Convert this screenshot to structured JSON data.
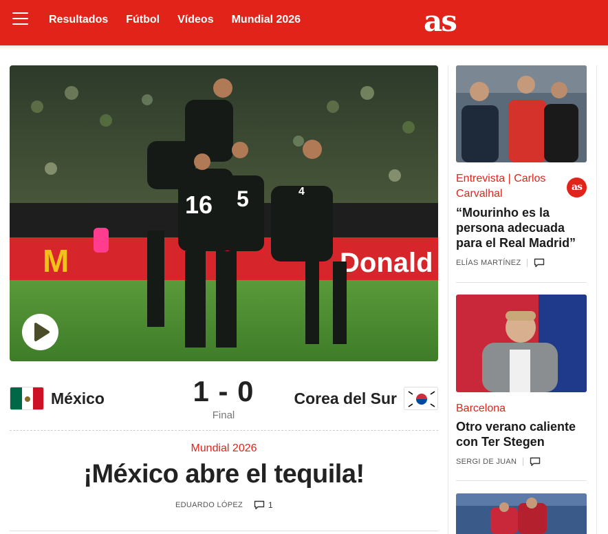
{
  "header": {
    "logo": "as",
    "nav": [
      "Resultados",
      "Fútbol",
      "Vídeos",
      "Mundial 2026"
    ]
  },
  "match": {
    "home_team": "México",
    "away_team": "Corea del Sur",
    "score": "1 - 0",
    "status": "Final"
  },
  "article": {
    "kicker": "Mundial 2026",
    "headline": "¡México abre el tequila!",
    "author": "EDUARDO LÓPEZ",
    "comments": "1"
  },
  "sidebar": [
    {
      "kicker": "Entrevista | Carlos Carvalhal",
      "title": "“Mourinho es la persona adecuada para el Real Madrid”",
      "author": "ELÍAS MARTÍNEZ",
      "badge": "as"
    },
    {
      "kicker": "Barcelona",
      "title": "Otro verano caliente con Ter Stegen",
      "author": "SERGI DE JUAN"
    }
  ],
  "colors": {
    "brand": "#e2231a",
    "mexico_green": "#006847",
    "mexico_red": "#ce1126",
    "korea_red": "#cd2e3a",
    "korea_blue": "#0047a0"
  }
}
